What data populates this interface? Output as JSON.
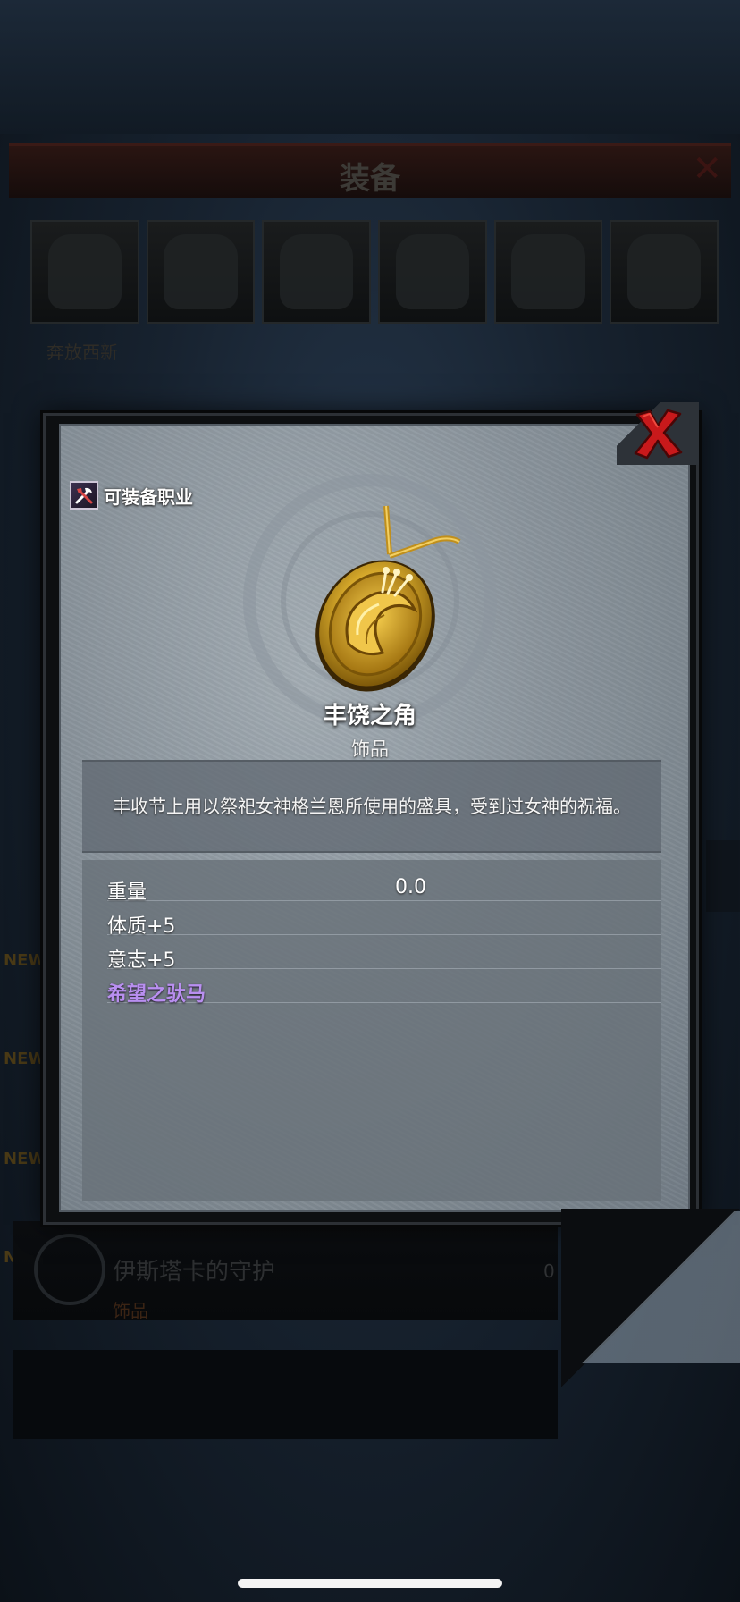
{
  "background": {
    "title": "装备",
    "subtitle": "奔放西新",
    "new_badge": "NEW",
    "list_item": {
      "name": "伊斯塔卡的守护",
      "type": "饰品",
      "count": "0"
    }
  },
  "dialog": {
    "class_label": "可装备职业",
    "item_name": "丰饶之角",
    "item_type": "饰品",
    "description": "丰收节上用以祭祀女神格兰恩所使用的盛具，受到过女神的祝福。",
    "stats": [
      {
        "label": "重量",
        "value": "0.0"
      },
      {
        "label": "体质+5",
        "value": ""
      },
      {
        "label": "意志+5",
        "value": ""
      },
      {
        "label": "希望之驮马",
        "value": ""
      }
    ]
  },
  "colors": {
    "set_bonus_purple": "#b98ff0",
    "close_red": "#d11f1f",
    "gold": "#d4a72a"
  }
}
